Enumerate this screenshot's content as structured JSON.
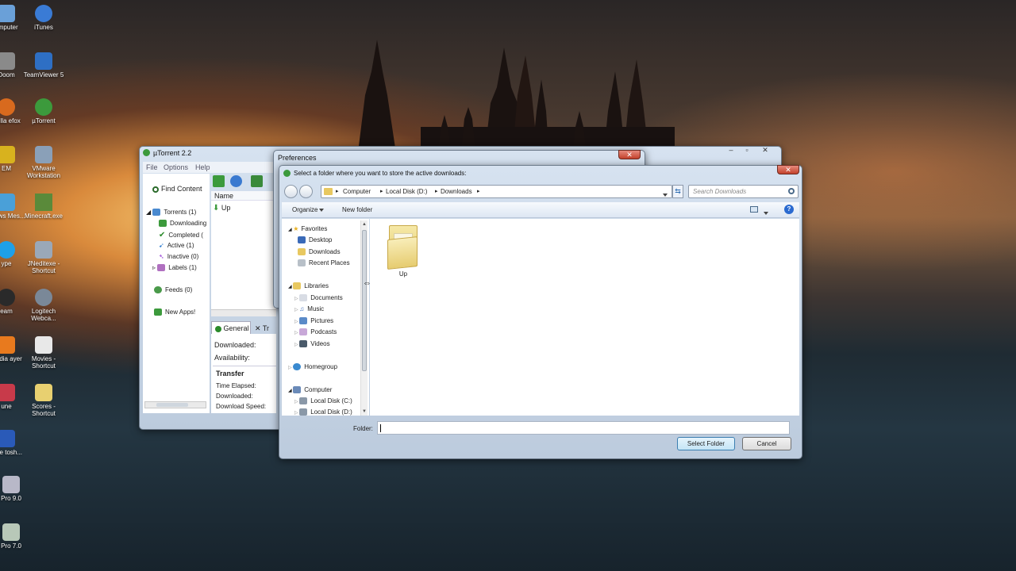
{
  "desktop": {
    "icons": [
      {
        "label": "omputer",
        "color": "#6aa0d8"
      },
      {
        "label": "iTunes",
        "color": "#3a7bd5"
      },
      {
        "label": "Doom",
        "color": "#8a8a8a"
      },
      {
        "label": "TeamViewer 5",
        "color": "#2e6fc4"
      },
      {
        "label": "ozilla efox",
        "color": "#d86a1e"
      },
      {
        "label": "µTorrent",
        "color": "#3c9a3c"
      },
      {
        "label": "EM",
        "color": "#d8b21e"
      },
      {
        "label": "VMware Workstation",
        "color": "#8aa0b8"
      },
      {
        "label": "ndows Mes...",
        "color": "#4aa0d8"
      },
      {
        "label": "Minecraft.exe",
        "color": "#5a8a3a"
      },
      {
        "label": "ype",
        "color": "#1ea0e8"
      },
      {
        "label": "JNeditexe - Shortcut",
        "color": "#9aa8b8"
      },
      {
        "label": "eam",
        "color": "#2a2a2a"
      },
      {
        "label": "Logitech Webca...",
        "color": "#7a8898"
      },
      {
        "label": "media ayer",
        "color": "#e87a1e"
      },
      {
        "label": "Movies - Shortcut",
        "color": "#e8e8e8"
      },
      {
        "label": "une",
        "color": "#c83a4a"
      },
      {
        "label": "Scores - Shortcut",
        "color": "#e8d070"
      },
      {
        "label": "robe tosh...",
        "color": "#2a5ab8"
      },
      {
        "label": "Pro 9.0",
        "color": "#b8b8c8"
      },
      {
        "label": "Pro 7.0",
        "color": "#b8c8b8"
      }
    ]
  },
  "utorrent": {
    "title": "µTorrent 2.2",
    "menu": [
      "File",
      "Options",
      "Help"
    ],
    "find_content": "Find Content",
    "tree": {
      "torrents": "Torrents (1)",
      "downloading": "Downloading",
      "completed": "Completed (",
      "active": "Active (1)",
      "inactive": "Inactive (0)",
      "labels": "Labels (1)",
      "feeds": "Feeds (0)",
      "new_apps": "New Apps!"
    },
    "list_header_name": "Name",
    "list_item": "Up",
    "tabs": {
      "general": "General",
      "trackers": "Tr"
    },
    "info": {
      "downloaded": "Downloaded:",
      "availability": "Availability:",
      "transfer": "Transfer",
      "time_elapsed": "Time Elapsed:",
      "downloaded2": "Downloaded:",
      "download_speed": "Download Speed:"
    }
  },
  "preferences": {
    "title": "Preferences"
  },
  "dialog": {
    "title": "Select a folder where you want to store the active downloads:",
    "breadcrumb": [
      "Computer",
      "Local Disk (D:)",
      "Downloads"
    ],
    "search_placeholder": "Search Downloads",
    "organize": "Organize",
    "new_folder": "New folder",
    "nav": {
      "favorites": "Favorites",
      "desktop": "Desktop",
      "downloads": "Downloads",
      "recent_places": "Recent Places",
      "libraries": "Libraries",
      "documents": "Documents",
      "music": "Music",
      "pictures": "Pictures",
      "podcasts": "Podcasts",
      "videos": "Videos",
      "homegroup": "Homegroup",
      "computer": "Computer",
      "local_c": "Local Disk (C:)",
      "local_d": "Local Disk (D:)"
    },
    "folder_item": "Up",
    "folder_label": "Folder:",
    "folder_value": "",
    "select_button": "Select Folder",
    "cancel_button": "Cancel"
  }
}
